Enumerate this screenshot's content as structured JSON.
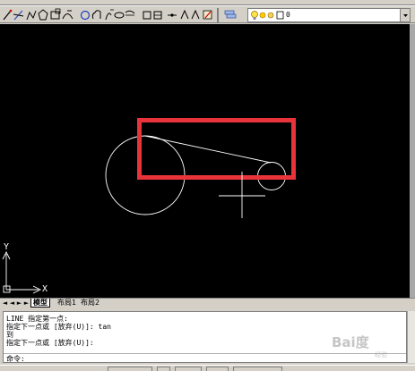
{
  "toolbar": {
    "layer_name": "0"
  },
  "canvas": {
    "ucs_y_label": "Y",
    "ucs_x_label": "X",
    "highlight_color": "#e8333a",
    "geometry_color": "#ffffff"
  },
  "tabs": {
    "model": "模型",
    "layout1": "布局1",
    "layout2": "布局2"
  },
  "command": {
    "line1": "LINE 指定第一点:",
    "line2": "指定下一点或 [放弃(U)]: tan",
    "line3": "到",
    "line4": "指定下一点或 [放弃(U)]:",
    "prompt": "命令:"
  },
  "watermark": {
    "text": "Bai度",
    "sub": "经验"
  }
}
